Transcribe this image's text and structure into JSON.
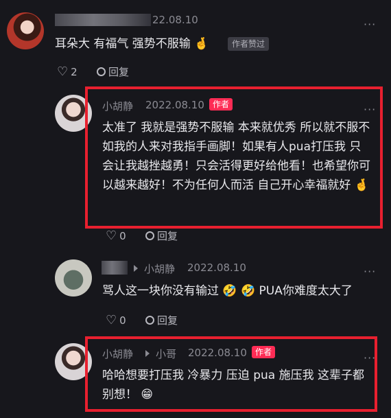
{
  "comment1": {
    "date_partial": "22.08.10",
    "text": "耳朵大 有福气 强势不服输 🤞",
    "badge": "作者赞过",
    "like_count": "2",
    "reply_label": "回复"
  },
  "reply1": {
    "author": "小胡静",
    "date": "2022.08.10",
    "badge": "作者",
    "text": "太准了 我就是强势不服输 本来就优秀 所以就不服不如我的人来对我指手画脚！如果有人pua打压我 只会让我越挫越勇！只会活得更好给他看！也希望你可以越来越好！不为任何人而活 自己开心幸福就好 🤞",
    "like_count": "0",
    "reply_label": "回复"
  },
  "reply2": {
    "reply_to": "小胡静",
    "date": "2022.08.10",
    "text": "骂人这一块你没有输过 🤣 🤣 PUA你难度太大了",
    "like_count": "0",
    "reply_label": "回复"
  },
  "reply3": {
    "author": "小胡静",
    "reply_to": "小哥",
    "date": "2022.08.10",
    "badge": "作者",
    "text": "哈哈想要打压我 冷暴力 压迫 pua 施压我 这辈子都别想！ 😁"
  },
  "more_glyph": "···",
  "colors": {
    "accent": "#fe2c55",
    "highlight_box": "#e8202f",
    "background": "#17171c"
  }
}
